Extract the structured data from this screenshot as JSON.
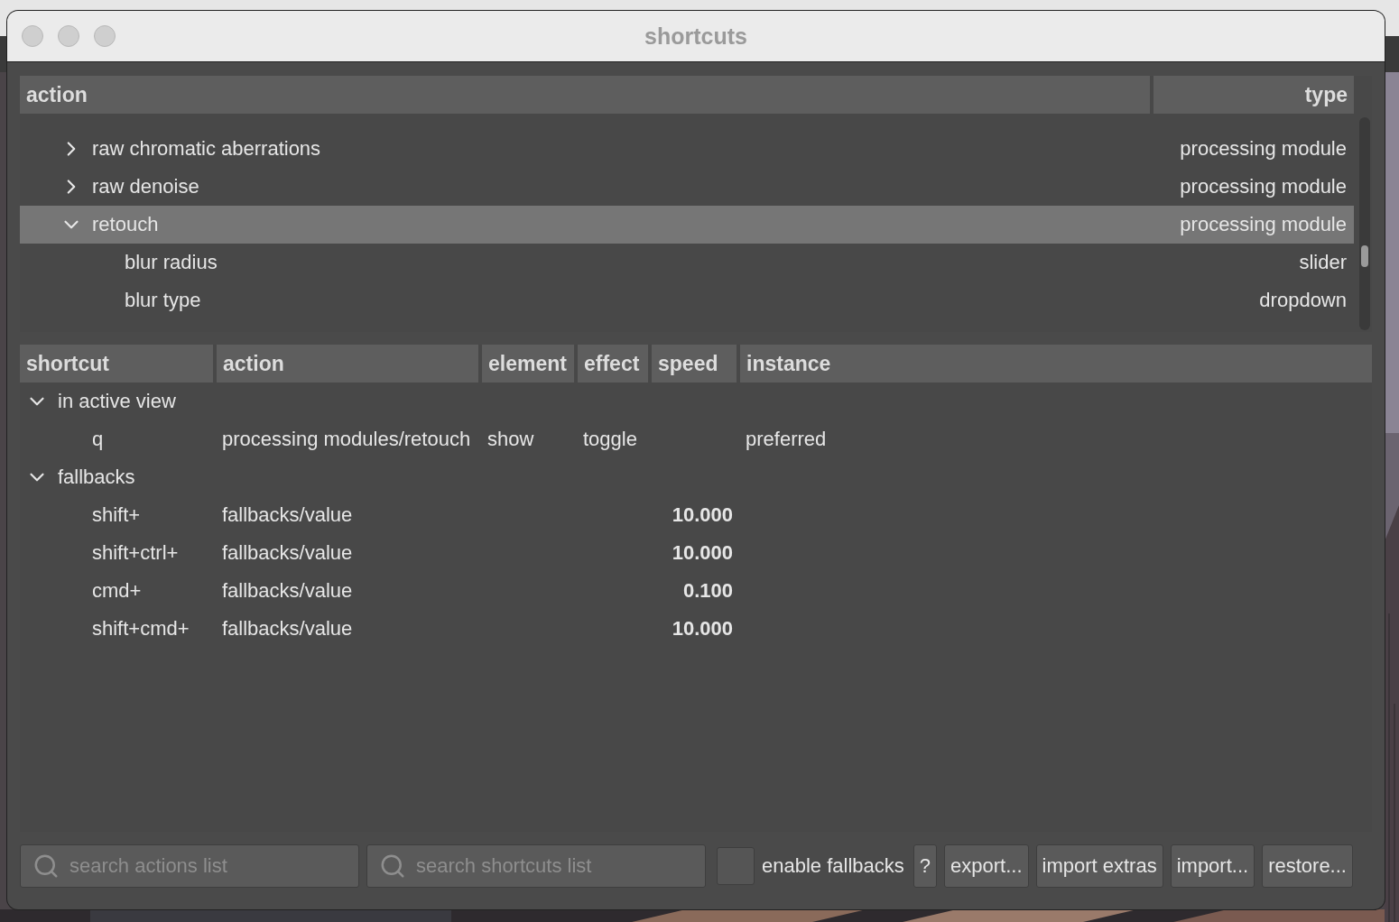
{
  "window": {
    "title": "shortcuts"
  },
  "actions_tree": {
    "columns": [
      "action",
      "type"
    ],
    "rows": [
      {
        "label": "raw chromatic aberrations",
        "type": "processing module",
        "expanded": false,
        "selected": false
      },
      {
        "label": "raw denoise",
        "type": "processing module",
        "expanded": false,
        "selected": false
      },
      {
        "label": "retouch",
        "type": "processing module",
        "expanded": true,
        "selected": true,
        "children": [
          {
            "label": "blur radius",
            "type": "slider"
          },
          {
            "label": "blur type",
            "type": "dropdown"
          }
        ]
      }
    ]
  },
  "shortcuts_table": {
    "columns": [
      "shortcut",
      "action",
      "element",
      "effect",
      "speed",
      "instance"
    ],
    "groups": [
      {
        "label": "in active view",
        "expanded": true,
        "rows": [
          {
            "shortcut": "q",
            "action": "processing modules/retouch",
            "element": "show",
            "effect": "toggle",
            "speed": "",
            "instance": "preferred"
          }
        ]
      },
      {
        "label": "fallbacks",
        "expanded": true,
        "rows": [
          {
            "shortcut": "shift+",
            "action": "fallbacks/value",
            "element": "",
            "effect": "",
            "speed": "10.000",
            "instance": ""
          },
          {
            "shortcut": "shift+ctrl+",
            "action": "fallbacks/value",
            "element": "",
            "effect": "",
            "speed": "10.000",
            "instance": ""
          },
          {
            "shortcut": "cmd+",
            "action": "fallbacks/value",
            "element": "",
            "effect": "",
            "speed": "0.100",
            "instance": ""
          },
          {
            "shortcut": "shift+cmd+",
            "action": "fallbacks/value",
            "element": "",
            "effect": "",
            "speed": "10.000",
            "instance": ""
          }
        ]
      }
    ]
  },
  "bottom_bar": {
    "search_actions": {
      "placeholder": "search actions list"
    },
    "search_shortcuts": {
      "placeholder": "search shortcuts list"
    },
    "enable_fallbacks": {
      "label": "enable fallbacks",
      "checked": false
    },
    "buttons": [
      "?",
      "export...",
      "import extras",
      "import...",
      "restore..."
    ]
  }
}
